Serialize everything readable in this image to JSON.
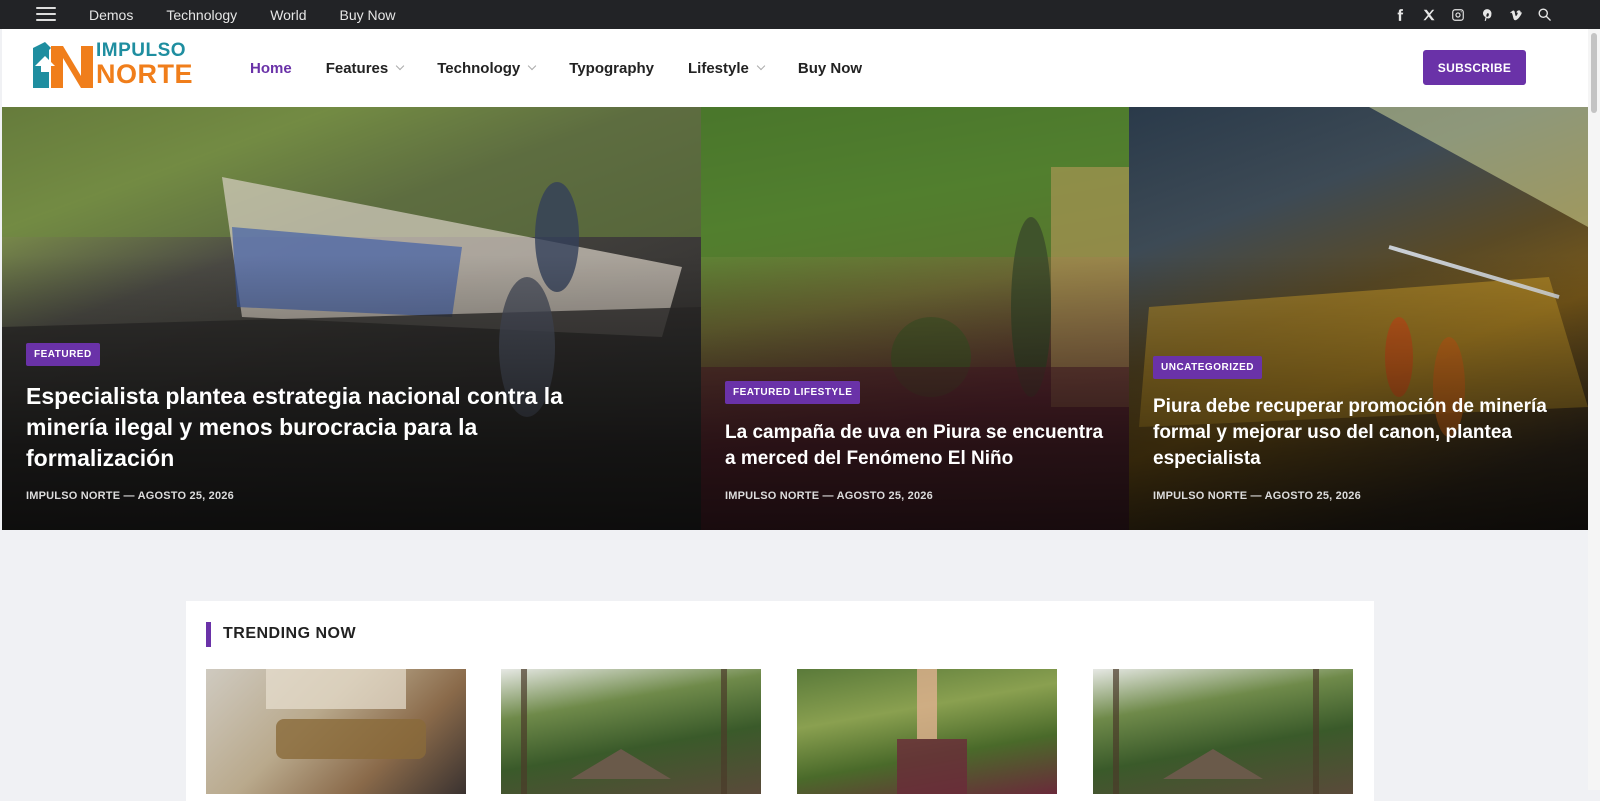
{
  "topbar": {
    "links": [
      "Demos",
      "Technology",
      "World",
      "Buy Now"
    ],
    "social_icons": [
      "facebook-icon",
      "x-twitter-icon",
      "instagram-icon",
      "pinterest-icon",
      "vimeo-icon"
    ]
  },
  "header": {
    "logo_line1": "IMPULSO",
    "logo_line2": "NORTE",
    "nav": [
      {
        "label": "Home",
        "active": true,
        "dropdown": false
      },
      {
        "label": "Features",
        "active": false,
        "dropdown": true
      },
      {
        "label": "Technology",
        "active": false,
        "dropdown": true
      },
      {
        "label": "Typography",
        "active": false,
        "dropdown": false
      },
      {
        "label": "Lifestyle",
        "active": false,
        "dropdown": true
      },
      {
        "label": "Buy Now",
        "active": false,
        "dropdown": false
      }
    ],
    "subscribe_label": "SUBSCRIBE"
  },
  "hero": [
    {
      "badge": "FEATURED",
      "title": "Especialista plantea estrategia nacional contra la minería ilegal y menos burocracia para la formalización",
      "meta": "IMPULSO NORTE — AGOSTO 25, 2026"
    },
    {
      "badge": "FEATURED LIFESTYLE",
      "title": "La campaña de uva en Piura se encuentra a merced del Fenómeno El Niño",
      "meta": "IMPULSO NORTE — AGOSTO 25, 2026"
    },
    {
      "badge": "UNCATEGORIZED",
      "title": "Piura debe recuperar promoción de minería formal y mejorar uso del canon, plantea especialista",
      "meta": "IMPULSO NORTE — AGOSTO 25, 2026"
    }
  ],
  "trending": {
    "heading": "TRENDING NOW"
  },
  "colors": {
    "accent": "#6a32a8",
    "topbar": "#222326",
    "logo_teal": "#1f8ea0",
    "logo_orange": "#f07e1b"
  }
}
